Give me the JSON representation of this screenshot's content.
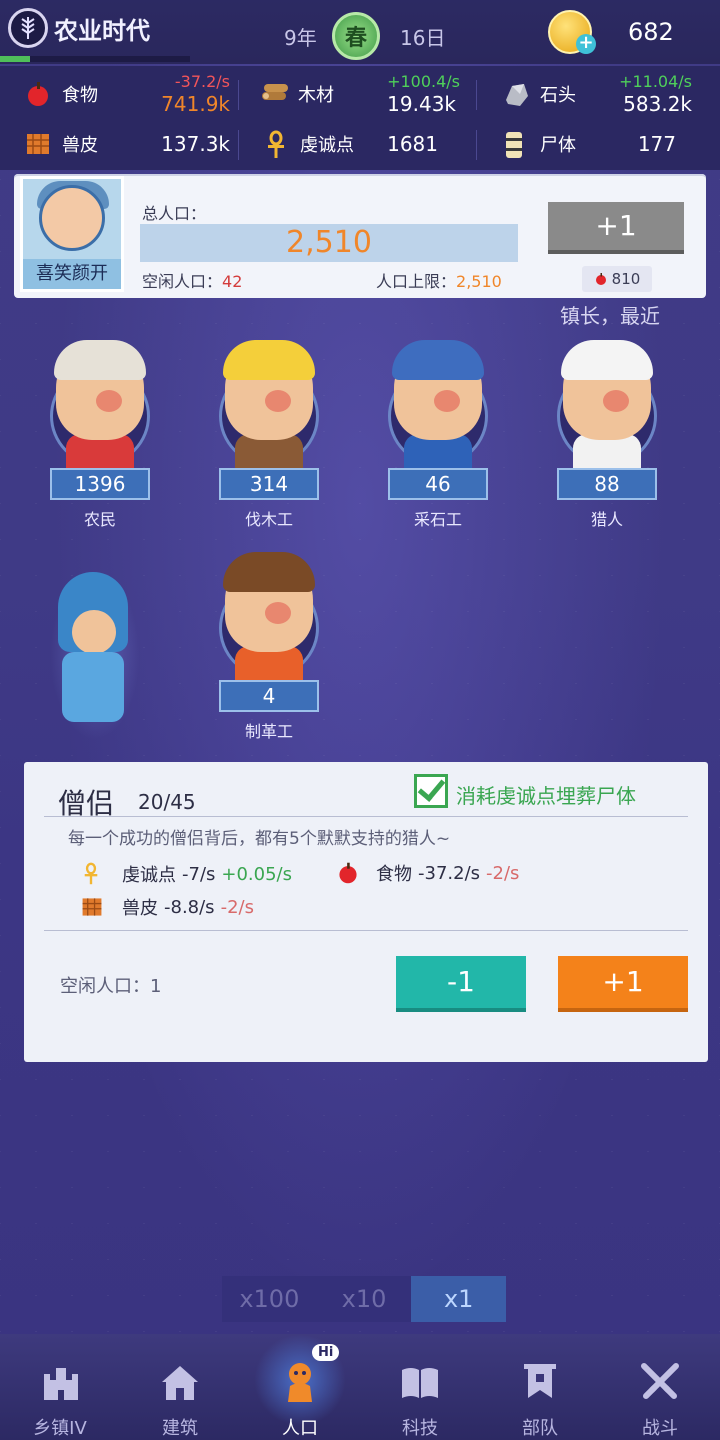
{
  "header": {
    "era": "农业时代",
    "era_progress": 0.16,
    "year": "9年",
    "season": "春",
    "day": "16日",
    "coins": "682"
  },
  "resources": [
    {
      "icon": "apple-icon",
      "name": "食物",
      "rate": "-37.2/s",
      "amount": "741.9k"
    },
    {
      "icon": "wood-icon",
      "name": "木材",
      "rate": "+100.4/s",
      "amount": "19.43k"
    },
    {
      "icon": "stone-icon",
      "name": "石头",
      "rate": "+11.04/s",
      "amount": "583.2k"
    },
    {
      "icon": "hide-icon",
      "name": "兽皮",
      "rate": "",
      "amount": "137.3k"
    },
    {
      "icon": "ankh-icon",
      "name": "虔诚点",
      "rate": "",
      "amount": "1681"
    },
    {
      "icon": "corpse-icon",
      "name": "尸体",
      "rate": "",
      "amount": "177"
    }
  ],
  "population": {
    "avatar_label": "喜笑颜开",
    "total_label": "总人口：",
    "total": "2,510",
    "idle_label": "空闲人口：",
    "idle": "42",
    "cap_label": "人口上限：",
    "cap": "2,510",
    "add_label": "+1",
    "cost": "810",
    "marquee": "镇长，最近"
  },
  "workers": [
    {
      "label": "农民",
      "count": "1396"
    },
    {
      "label": "伐木工",
      "count": "314"
    },
    {
      "label": "采石工",
      "count": "46"
    },
    {
      "label": "猎人",
      "count": "88"
    },
    {
      "label": "制革工",
      "count": "4"
    }
  ],
  "monk": {
    "title": "僧侣",
    "capacity": "20/45",
    "checkbox_label": "消耗虔诚点埋葬尸体",
    "checked": true,
    "description": "每一个成功的僧侣背后，都有5个默默支持的猎人~",
    "effects": [
      {
        "name": "虔诚点",
        "value": "-7/s",
        "delta": "+0.05/s"
      },
      {
        "name": "食物",
        "value": "-37.2/s",
        "delta": "-2/s"
      },
      {
        "name": "兽皮",
        "value": "-8.8/s",
        "delta": "-2/s"
      }
    ],
    "idle_text": "空闲人口：1",
    "minus_label": "-1",
    "plus_label": "+1"
  },
  "multiplier": {
    "options": [
      "x100",
      "x10",
      "x1"
    ],
    "active": "x1"
  },
  "nav": [
    {
      "label": "乡镇IV",
      "icon": "castle-icon"
    },
    {
      "label": "建筑",
      "icon": "house-icon"
    },
    {
      "label": "人口",
      "icon": "person-icon",
      "badge": "Hi"
    },
    {
      "label": "科技",
      "icon": "book-icon"
    },
    {
      "label": "部队",
      "icon": "banner-icon"
    },
    {
      "label": "战斗",
      "icon": "swords-icon"
    }
  ],
  "colors": {
    "background": "#3f3a86",
    "accent_orange": "#f4821a",
    "accent_teal": "#22b7a9",
    "positive": "#3aa651",
    "negative": "#d86a6a"
  }
}
